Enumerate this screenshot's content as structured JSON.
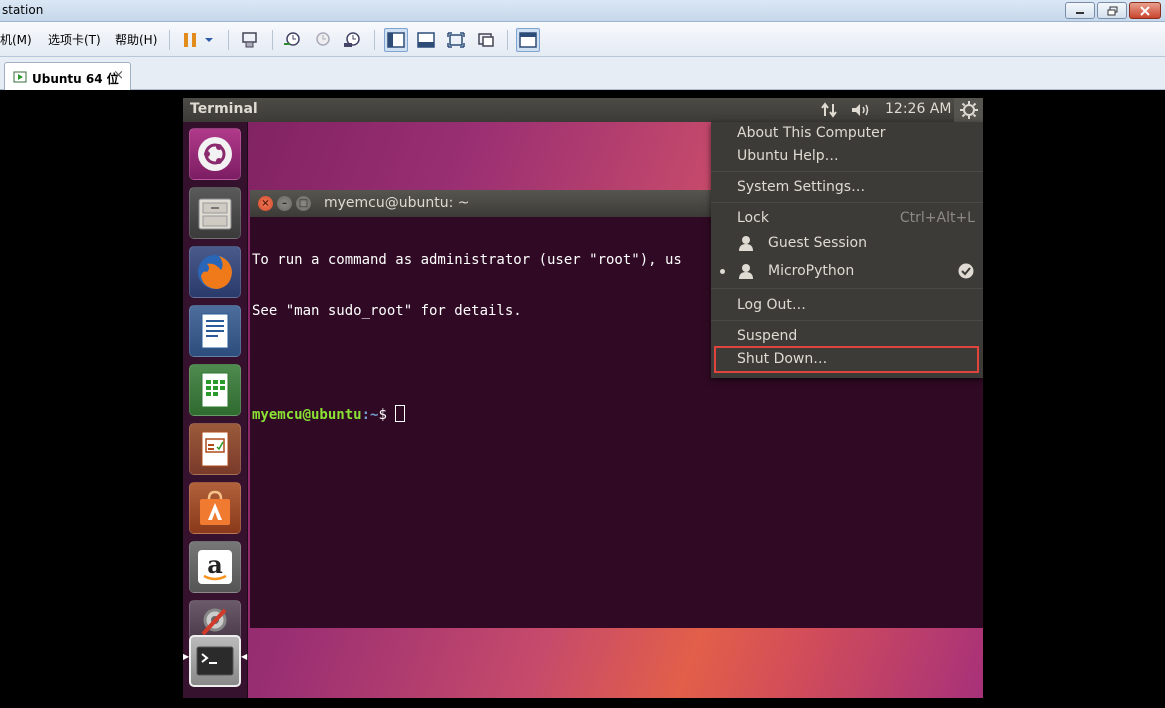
{
  "host": {
    "title": "station",
    "menu": [
      "机(M)",
      "选项卡(T)",
      "帮助(H)"
    ],
    "tab_label": "Ubuntu 64 位",
    "tab_close": "×"
  },
  "guest": {
    "panel_title": "Terminal",
    "clock": "12:26 AM",
    "terminal": {
      "title": "myemcu@ubuntu: ~",
      "lines": [
        "To run a command as administrator (user \"root\"), us",
        "See \"man sudo_root\" for details."
      ],
      "prompt_user": "myemcu@ubuntu",
      "prompt_path": ":~",
      "prompt_symbol": "$ "
    },
    "session_menu": {
      "about": "About This Computer",
      "help": "Ubuntu Help…",
      "settings": "System Settings…",
      "lock": "Lock",
      "lock_accel": "Ctrl+Alt+L",
      "guest_session": "Guest Session",
      "current_user": "MicroPython",
      "logout": "Log Out…",
      "suspend": "Suspend",
      "shutdown": "Shut Down…"
    }
  },
  "colors": {
    "highlight": "#e0443c",
    "terminal_bg": "#300a24",
    "prompt_user": "#8ae234",
    "prompt_path": "#729fcf"
  },
  "icons": {
    "launcher": [
      "ubuntu-dash-icon",
      "files-icon",
      "firefox-icon",
      "libreoffice-writer-icon",
      "libreoffice-calc-icon",
      "libreoffice-impress-icon",
      "software-center-icon",
      "amazon-icon",
      "system-settings-icon",
      "terminal-icon"
    ]
  }
}
